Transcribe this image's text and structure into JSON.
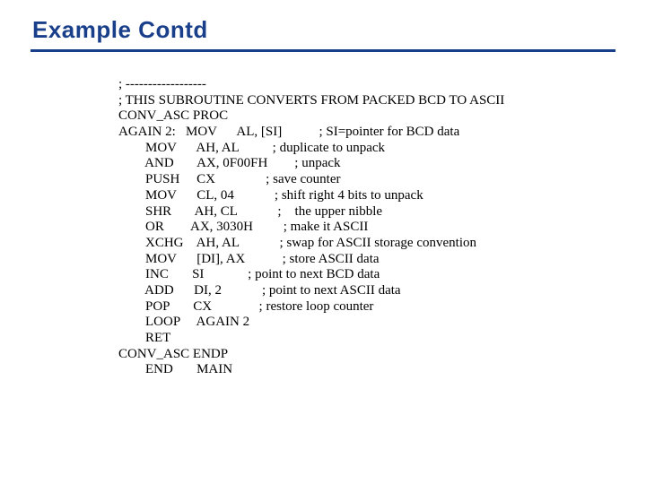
{
  "title": "Example Contd",
  "code": {
    "l00": "; ------------------",
    "l01": "; THIS SUBROUTINE CONVERTS FROM PACKED BCD TO ASCII",
    "l02": "CONV_ASC PROC",
    "l03": "AGAIN 2:   MOV      AL, [SI]           ; SI=pointer for BCD data",
    "l04": "        MOV      AH, AL          ; duplicate to unpack",
    "l05": "        AND       AX, 0F00FH        ; unpack",
    "l06": "        PUSH     CX               ; save counter",
    "l07": "        MOV      CL, 04            ; shift right 4 bits to unpack",
    "l08": "        SHR       AH, CL            ;    the upper nibble",
    "l09": "        OR        AX, 3030H         ; make it ASCII",
    "l10": "        XCHG    AH, AL            ; swap for ASCII storage convention",
    "l11": "        MOV      [DI], AX           ; store ASCII data",
    "l12": "        INC       SI             ; point to next BCD data",
    "l13": "        ADD      DI, 2            ; point to next ASCII data",
    "l14": "        POP       CX              ; restore loop counter",
    "l15": "        LOOP     AGAIN 2",
    "l16": "        RET",
    "l17": "CONV_ASC ENDP",
    "l18": "        END       MAIN"
  }
}
